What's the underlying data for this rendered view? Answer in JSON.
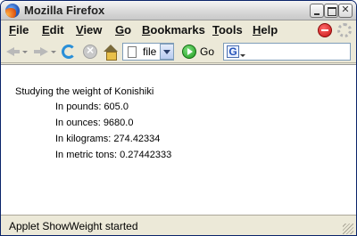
{
  "window": {
    "title": "Mozilla Firefox",
    "icon": "firefox-icon"
  },
  "menubar": {
    "items": [
      "File",
      "Edit",
      "View",
      "Go",
      "Bookmarks",
      "Tools",
      "Help"
    ]
  },
  "toolbar": {
    "url_value": "file",
    "go_label": "Go",
    "icons": [
      "back-icon",
      "forward-icon",
      "reload-icon",
      "stop-icon",
      "home-icon",
      "go-icon",
      "search-engine-icon"
    ]
  },
  "content": {
    "heading": "Studying the weight of Konishiki",
    "measurements": [
      "In pounds: 605.0",
      "In ounces: 9680.0",
      "In kilograms: 274.42334",
      "In metric tons: 0.27442333"
    ]
  },
  "status": {
    "text": "Applet ShowWeight started"
  },
  "colors": {
    "title_border": "#0a246a",
    "chrome": "#ece9d8",
    "content_bg": "#ffffff"
  }
}
